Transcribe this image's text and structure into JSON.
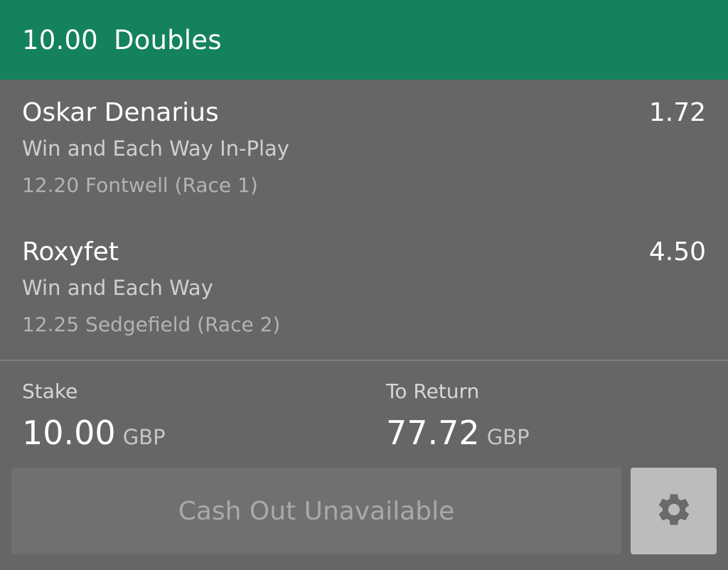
{
  "header": {
    "stake": "10.00",
    "bet_type": "Doubles",
    "color": "#14825c"
  },
  "selections": [
    {
      "name": "Oskar Denarius",
      "odds": "1.72",
      "market": "Win and Each Way In-Play",
      "event": "12.20 Fontwell (Race 1)"
    },
    {
      "name": "Roxyfet",
      "odds": "4.50",
      "market": "Win and Each Way",
      "event": "12.25 Sedgefield (Race 2)"
    }
  ],
  "summary": {
    "stake_label": "Stake",
    "stake_value": "10.00",
    "stake_currency": "GBP",
    "return_label": "To Return",
    "return_value": "77.72",
    "return_currency": "GBP"
  },
  "actions": {
    "cashout_label": "Cash Out Unavailable",
    "settings_icon": "gear-icon"
  }
}
